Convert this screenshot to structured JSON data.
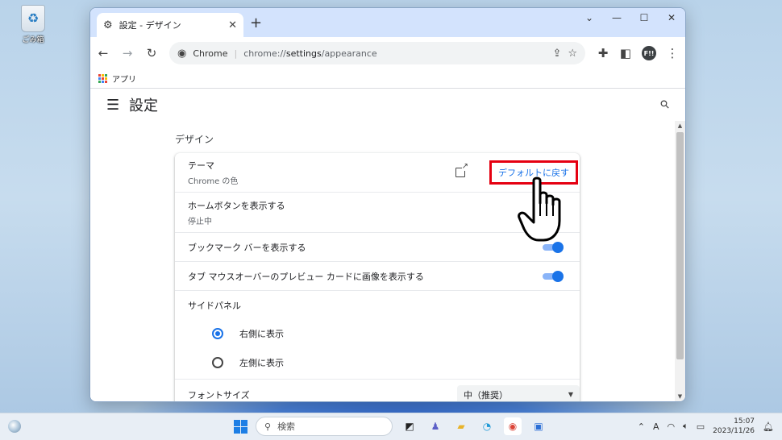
{
  "desktop": {
    "recycle_bin_label": "ごみ箱"
  },
  "browser": {
    "tab_title": "設定 - デザイン",
    "site_label": "Chrome",
    "url_prefix": "chrome://",
    "url_bold": "settings",
    "url_suffix": "/appearance",
    "profile_initials": "F!!",
    "bookmark_apps": "アプリ"
  },
  "settings": {
    "page_title": "設定",
    "section_title": "デザイン",
    "theme": {
      "label": "テーマ",
      "sub": "Chrome の色",
      "reset_button": "デフォルトに戻す"
    },
    "home_button": {
      "label": "ホームボタンを表示する",
      "sub": "停止中"
    },
    "bookmarks_bar": {
      "label": "ブックマーク バーを表示する"
    },
    "tab_preview": {
      "label": "タブ マウスオーバーのプレビュー カードに画像を表示する"
    },
    "side_panel": {
      "label": "サイドパネル",
      "options": [
        "右側に表示",
        "左側に表示"
      ]
    },
    "font_size": {
      "label": "フォントサイズ",
      "value": "中（推奨）"
    }
  },
  "taskbar": {
    "search_placeholder": "検索",
    "time": "15:07",
    "date": "2023/11/26",
    "ime": "A"
  }
}
